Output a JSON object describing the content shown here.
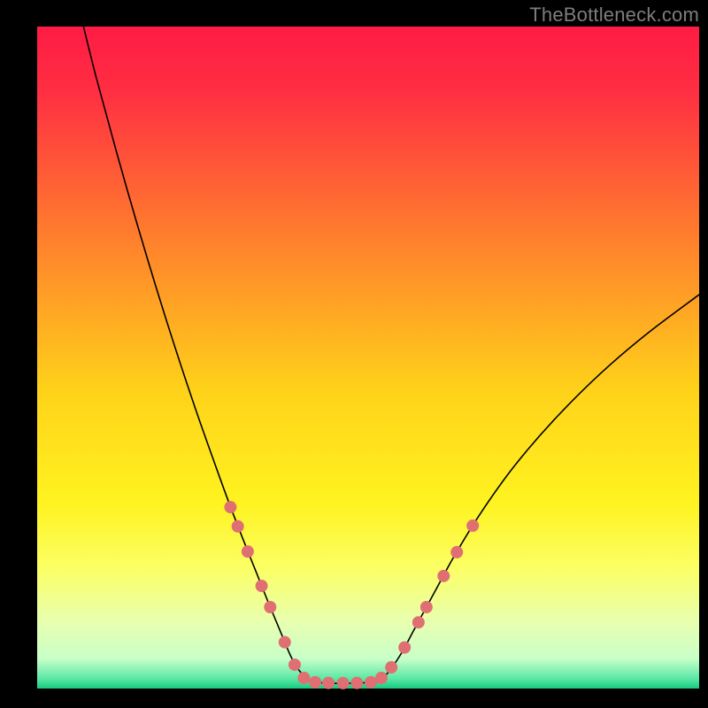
{
  "watermark": "TheBottleneck.com",
  "chart_data": {
    "type": "line",
    "title": "",
    "xlabel": "",
    "ylabel": "",
    "x_range": [
      0,
      100
    ],
    "y_range": [
      0,
      100
    ],
    "background_gradient": {
      "stops": [
        {
          "offset": 0.0,
          "color": "#ff1b44"
        },
        {
          "offset": 0.1,
          "color": "#ff2f42"
        },
        {
          "offset": 0.35,
          "color": "#ff8a2a"
        },
        {
          "offset": 0.55,
          "color": "#ffd21a"
        },
        {
          "offset": 0.72,
          "color": "#fff320"
        },
        {
          "offset": 0.82,
          "color": "#fbff66"
        },
        {
          "offset": 0.9,
          "color": "#e8ffb0"
        },
        {
          "offset": 0.955,
          "color": "#c8ffc8"
        },
        {
          "offset": 0.985,
          "color": "#5be8a6"
        },
        {
          "offset": 1.0,
          "color": "#18c97e"
        }
      ]
    },
    "series": [
      {
        "name": "left-curve",
        "type": "line",
        "color": "#000000",
        "width": 1.6,
        "points": [
          {
            "x": 7.0,
            "y": 100.0
          },
          {
            "x": 9.0,
            "y": 92.0
          },
          {
            "x": 12.0,
            "y": 81.0
          },
          {
            "x": 15.0,
            "y": 70.5
          },
          {
            "x": 18.0,
            "y": 60.5
          },
          {
            "x": 21.0,
            "y": 51.0
          },
          {
            "x": 24.0,
            "y": 42.0
          },
          {
            "x": 27.0,
            "y": 33.5
          },
          {
            "x": 29.0,
            "y": 28.0
          },
          {
            "x": 31.0,
            "y": 22.8
          },
          {
            "x": 33.0,
            "y": 17.8
          },
          {
            "x": 35.0,
            "y": 12.8
          },
          {
            "x": 37.0,
            "y": 8.0
          },
          {
            "x": 38.5,
            "y": 4.5
          },
          {
            "x": 40.0,
            "y": 2.2
          },
          {
            "x": 41.5,
            "y": 1.0
          }
        ]
      },
      {
        "name": "trough",
        "type": "line",
        "color": "#000000",
        "width": 1.6,
        "points": [
          {
            "x": 41.5,
            "y": 1.0
          },
          {
            "x": 44.0,
            "y": 0.8
          },
          {
            "x": 47.0,
            "y": 0.8
          },
          {
            "x": 50.0,
            "y": 0.9
          },
          {
            "x": 51.5,
            "y": 1.0
          }
        ]
      },
      {
        "name": "right-curve",
        "type": "line",
        "color": "#000000",
        "width": 1.6,
        "points": [
          {
            "x": 51.5,
            "y": 1.0
          },
          {
            "x": 53.0,
            "y": 2.4
          },
          {
            "x": 55.0,
            "y": 5.3
          },
          {
            "x": 57.0,
            "y": 9.0
          },
          {
            "x": 60.0,
            "y": 14.5
          },
          {
            "x": 63.0,
            "y": 20.0
          },
          {
            "x": 67.0,
            "y": 26.5
          },
          {
            "x": 72.0,
            "y": 33.5
          },
          {
            "x": 78.0,
            "y": 40.5
          },
          {
            "x": 85.0,
            "y": 47.5
          },
          {
            "x": 92.0,
            "y": 53.5
          },
          {
            "x": 100.0,
            "y": 59.5
          }
        ]
      },
      {
        "name": "left-dots",
        "type": "scatter",
        "color": "#e06f73",
        "radius": 7,
        "points": [
          {
            "x": 29.2,
            "y": 27.4
          },
          {
            "x": 30.3,
            "y": 24.5
          },
          {
            "x": 31.8,
            "y": 20.7
          },
          {
            "x": 33.9,
            "y": 15.5
          },
          {
            "x": 35.2,
            "y": 12.3
          },
          {
            "x": 37.4,
            "y": 7.0
          },
          {
            "x": 38.9,
            "y": 3.6
          },
          {
            "x": 40.3,
            "y": 1.6
          }
        ]
      },
      {
        "name": "trough-dots",
        "type": "scatter",
        "color": "#e06f73",
        "radius": 7,
        "points": [
          {
            "x": 42.0,
            "y": 0.95
          },
          {
            "x": 44.0,
            "y": 0.85
          },
          {
            "x": 46.2,
            "y": 0.82
          },
          {
            "x": 48.3,
            "y": 0.85
          },
          {
            "x": 50.4,
            "y": 0.95
          }
        ]
      },
      {
        "name": "right-dots",
        "type": "scatter",
        "color": "#e06f73",
        "radius": 7,
        "points": [
          {
            "x": 52.0,
            "y": 1.6
          },
          {
            "x": 53.5,
            "y": 3.2
          },
          {
            "x": 55.5,
            "y": 6.2
          },
          {
            "x": 57.6,
            "y": 10.0
          },
          {
            "x": 58.8,
            "y": 12.3
          },
          {
            "x": 61.4,
            "y": 17.0
          },
          {
            "x": 63.4,
            "y": 20.6
          },
          {
            "x": 65.8,
            "y": 24.6
          }
        ]
      }
    ]
  }
}
